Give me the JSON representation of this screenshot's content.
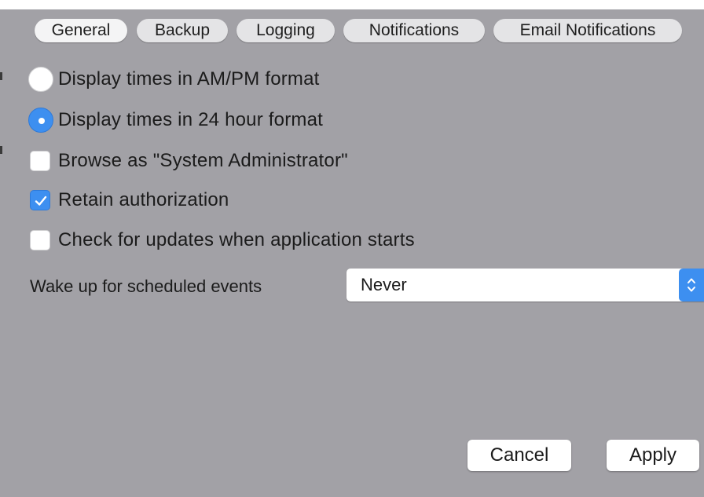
{
  "tabs": [
    {
      "label": "General",
      "selected": true
    },
    {
      "label": "Backup",
      "selected": false
    },
    {
      "label": "Logging",
      "selected": false
    },
    {
      "label": "Notifications",
      "selected": false
    },
    {
      "label": "Email Notifications",
      "selected": false
    }
  ],
  "options": {
    "ampm": {
      "label": "Display times in AM/PM format",
      "checked": false
    },
    "h24": {
      "label": "Display times in 24 hour format",
      "checked": true
    },
    "browse_admin": {
      "label": "Browse as \"System Administrator\"",
      "checked": false
    },
    "retain_auth": {
      "label": "Retain authorization",
      "checked": true
    },
    "check_updates": {
      "label": "Check for updates when application starts",
      "checked": false
    }
  },
  "wake": {
    "label": "Wake up for scheduled events",
    "value": "Never"
  },
  "buttons": {
    "cancel": "Cancel",
    "apply": "Apply"
  },
  "colors": {
    "background": "#a2a1a6",
    "accent": "#3d8ff0"
  }
}
